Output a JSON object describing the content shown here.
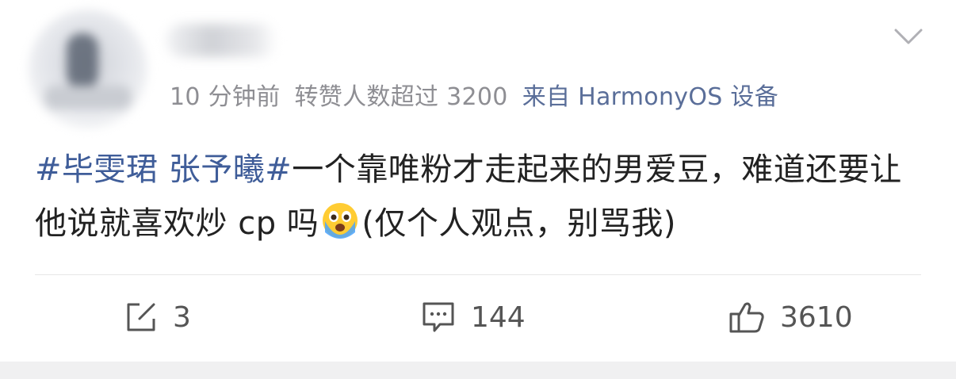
{
  "post": {
    "time": "10 分钟前",
    "repost_note": "转赞人数超过 3200",
    "source": "来自 HarmonyOS 设备",
    "hashtag": "#毕雯珺 张予曦#",
    "text_part1": "一个靠唯粉才走起来的男爱豆，难道还要让他说就喜欢炒 cp 吗",
    "emoji": "crying-face-emoji",
    "text_part2": "(仅个人观点，别骂我)"
  },
  "actions": {
    "repost_count": "3",
    "comment_count": "144",
    "like_count": "3610"
  },
  "icons": {
    "menu": "chevron-down-icon",
    "repost": "repost-icon",
    "comment": "comment-icon",
    "like": "thumbs-up-icon"
  },
  "colors": {
    "link_blue": "#3f5d99",
    "meta_gray": "#8e8e93",
    "icon_gray": "#555555",
    "background_gap": "#f0f0f1"
  }
}
